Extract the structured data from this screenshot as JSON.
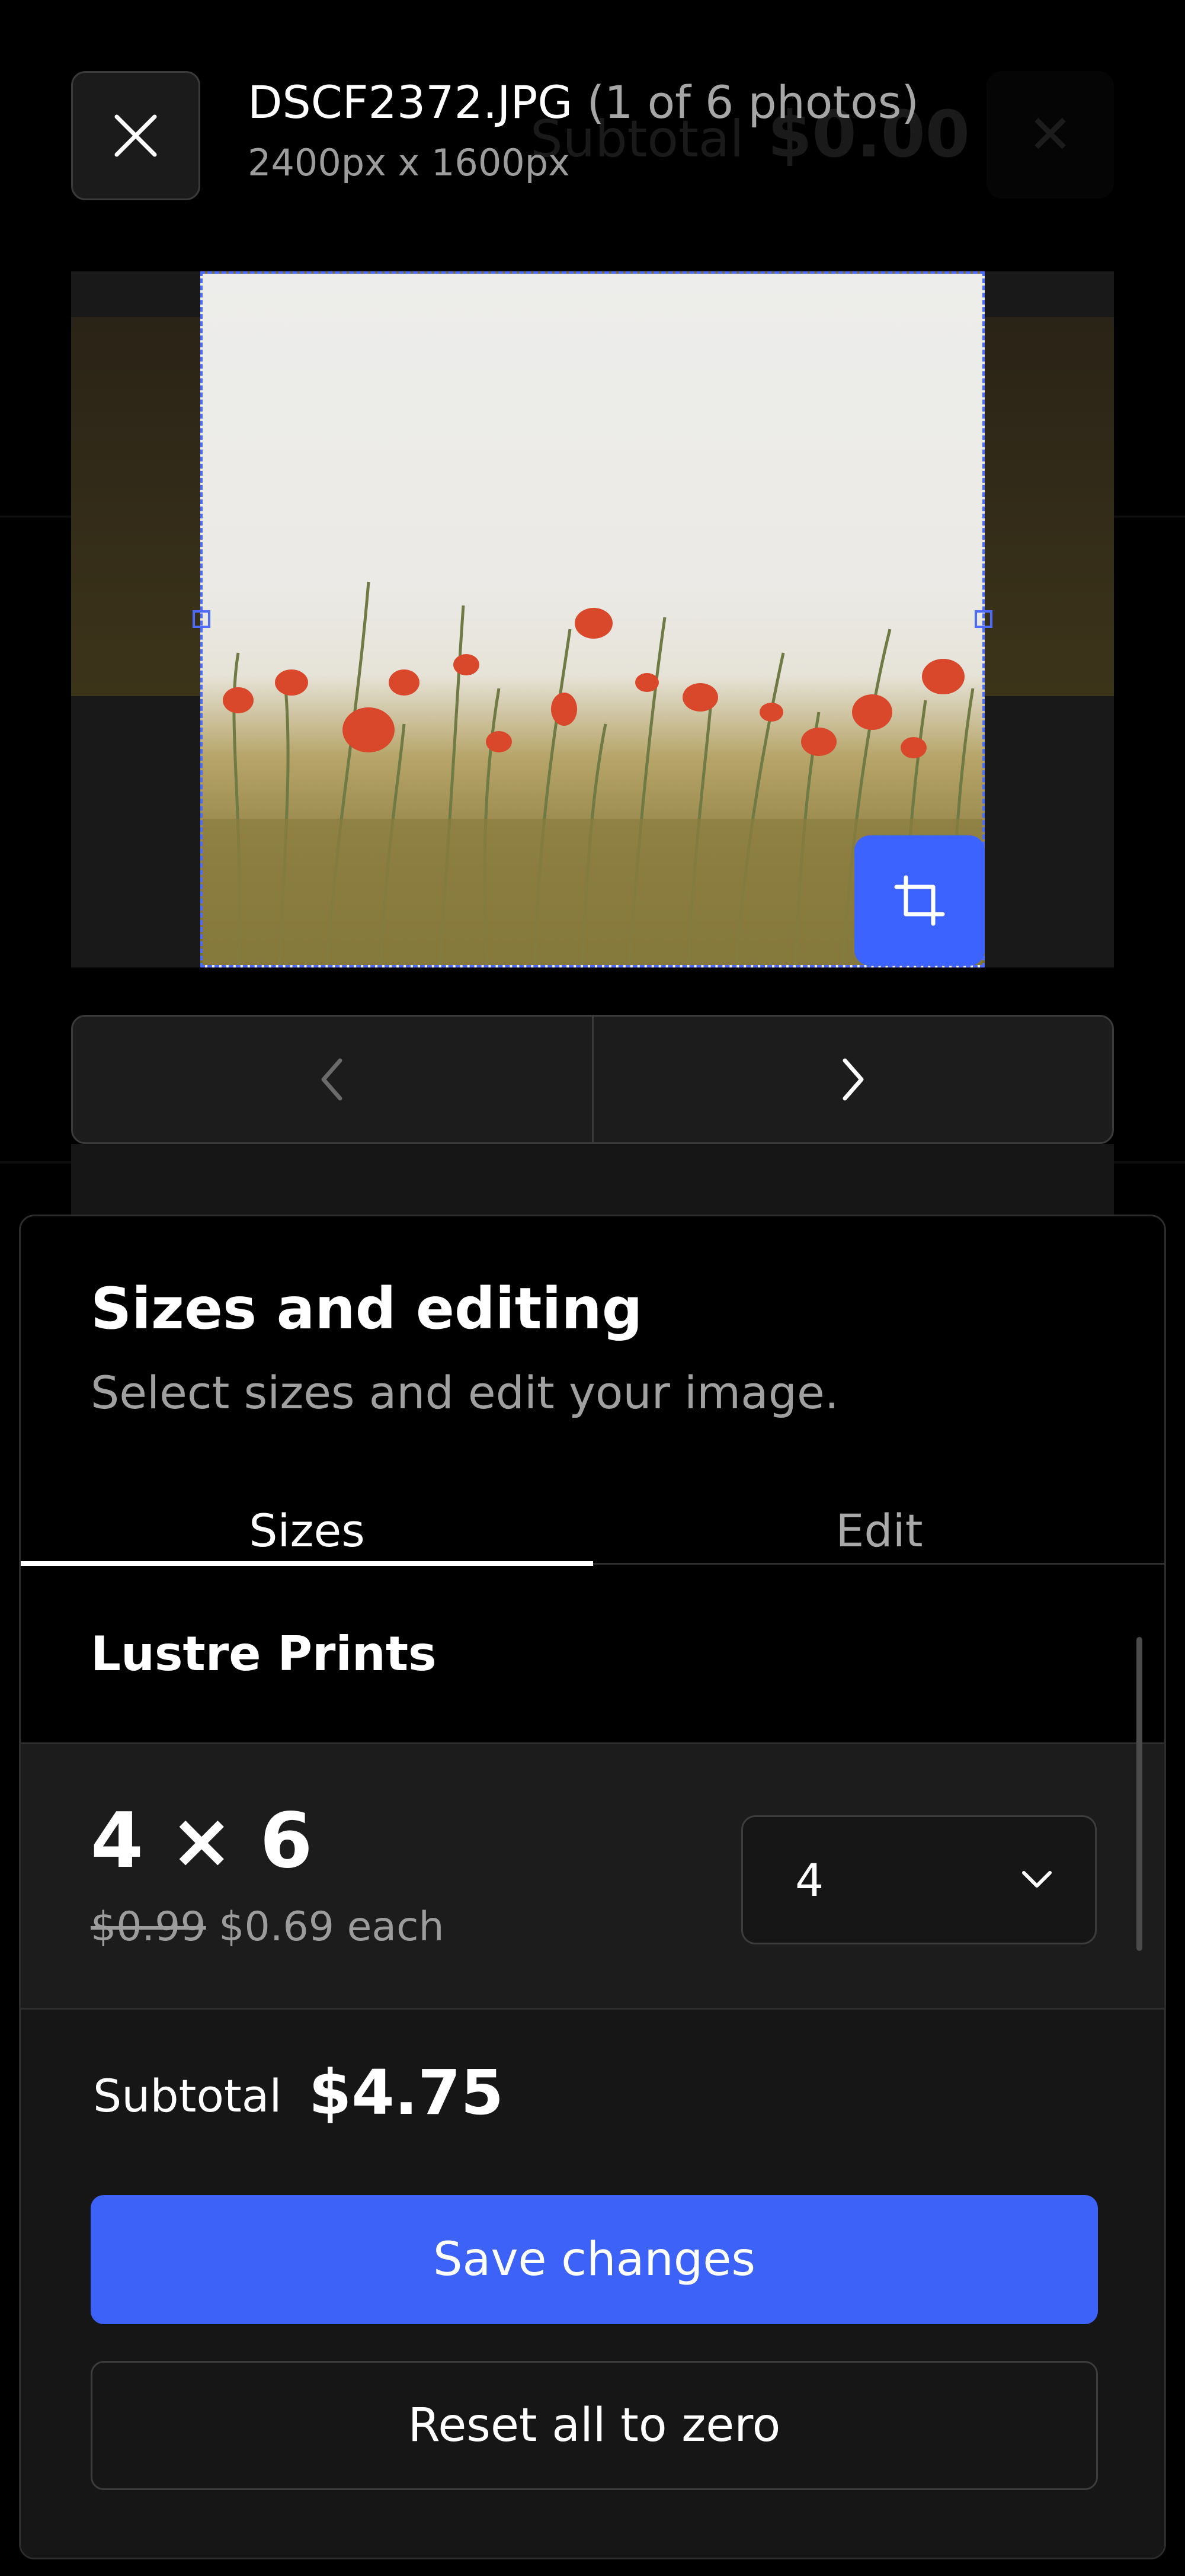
{
  "background": {
    "subtotal_label": "Subtotal",
    "subtotal_value": "$0.00",
    "close_glyph": "✕"
  },
  "header": {
    "filename": "DSCF2372.JPG",
    "photo_count": "(1 of 6 photos)",
    "dimensions": "2400px x 1600px",
    "close_icon": "close-icon"
  },
  "preview": {
    "crop_icon": "crop-icon",
    "prev_icon": "chevron-left-icon",
    "next_icon": "chevron-right-icon"
  },
  "sheet": {
    "title": "Sizes and editing",
    "subtitle": "Select sizes and edit your image.",
    "tabs": [
      {
        "label": "Sizes",
        "active": true
      },
      {
        "label": "Edit",
        "active": false
      }
    ],
    "section_title": "Lustre Prints",
    "size": {
      "name": "4 × 6",
      "old_price": "$0.99",
      "price": "$0.69 each",
      "quantity": "4"
    },
    "subtotal_label": "Subtotal",
    "subtotal_value": "$4.75",
    "save_label": "Save changes",
    "reset_label": "Reset all to zero"
  },
  "colors": {
    "accent": "#3d63ff",
    "background": "#000000",
    "surface": "#1c1c1c"
  }
}
